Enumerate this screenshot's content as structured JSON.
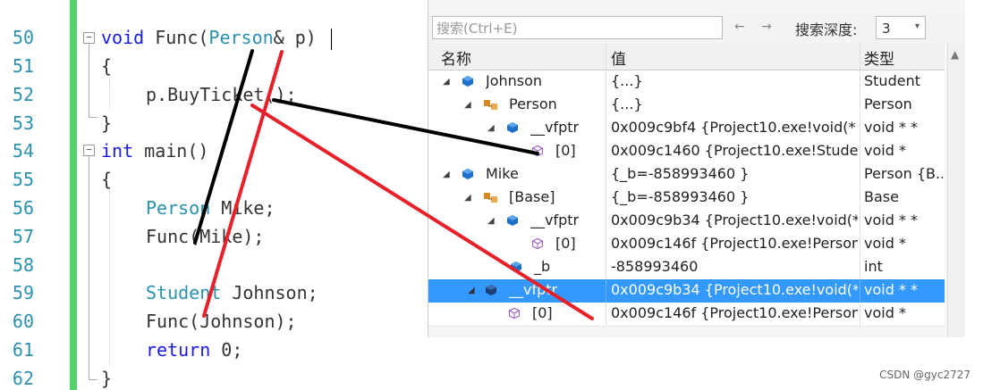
{
  "editor": {
    "line_numbers": [
      "50",
      "51",
      "52",
      "53",
      "54",
      "55",
      "56",
      "57",
      "58",
      "59",
      "60",
      "61",
      "62"
    ],
    "lines": {
      "l50": {
        "kw": "void",
        "fn": " Func(",
        "ty": "Person",
        "rest": "& p)"
      },
      "l51": "{",
      "l52": "p.BuyTicket();",
      "l53": "}",
      "l54": {
        "kw": "int",
        "rest": " main()"
      },
      "l55": "{",
      "l56": {
        "ty": "Person",
        "rest": " Mike;"
      },
      "l57": "Func(Mike);",
      "l59": {
        "ty": "Student",
        "rest": " Johnson;"
      },
      "l60": "Func(Johnson);",
      "l61": {
        "kw": "return",
        "rest": " 0;"
      },
      "l62": "}"
    },
    "fold_symbol": "−"
  },
  "panel": {
    "search_placeholder": "搜索(Ctrl+E)",
    "nav_back": "←",
    "nav_forward": "→",
    "depth_label": "搜索深度:",
    "depth_value": "3",
    "depth_arrow": "▾",
    "columns": {
      "name": "名称",
      "value": "值",
      "type": "类型"
    },
    "rows": [
      {
        "name": "Johnson",
        "value": "{...}",
        "type": "Student"
      },
      {
        "name": "Person",
        "value": "{...}",
        "type": "Person"
      },
      {
        "name": "__vfptr",
        "value": "0x009c9bf4 {Project10.exe!void(* ...",
        "type": "void * *"
      },
      {
        "name": "[0]",
        "value": "0x009c1460 {Project10.exe!Stude...",
        "type": "void *"
      },
      {
        "name": "Mike",
        "value": "{_b=-858993460 }",
        "type": "Person {B..."
      },
      {
        "name": "[Base]",
        "value": "{_b=-858993460 }",
        "type": "Base"
      },
      {
        "name": "__vfptr",
        "value": "0x009c9b34 {Project10.exe!void(*...",
        "type": "void * *"
      },
      {
        "name": "[0]",
        "value": "0x009c146f {Project10.exe!Person...",
        "type": "void *"
      },
      {
        "name": "_b",
        "value": "-858993460",
        "type": "int"
      },
      {
        "name": "__vfptr",
        "value": "0x009c9b34 {Project10.exe!void(*...",
        "type": "void * *"
      },
      {
        "name": "[0]",
        "value": "0x009c146f {Project10.exe!Person...",
        "type": "void *"
      }
    ],
    "expand_glyph": "◢",
    "colors": {
      "selection": "#3399ff",
      "cube": "#1e6fc9",
      "base": "#d98a1e",
      "element": "#9a5fc4"
    }
  },
  "watermark": "CSDN @gyc2727",
  "annotation_colors": {
    "black": "#000000",
    "red": "#e8202a"
  }
}
